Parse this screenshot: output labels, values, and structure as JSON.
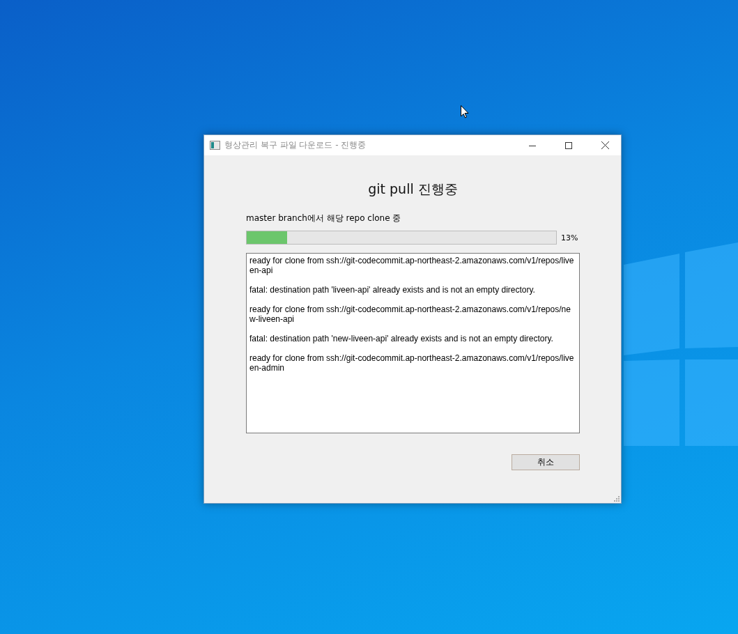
{
  "window": {
    "title": "형상관리 복구 파일 다운로드 - 진행중"
  },
  "heading": "git pull 진행중",
  "status": "master branch에서 해당 repo clone 중",
  "progress": {
    "level": 0.13,
    "reading": "13%"
  },
  "log": [
    "ready for clone from ssh://git-codecommit.ap-northeast-2.amazonaws.com/v1/repos/liveen-api",
    "fatal: destination path 'liveen-api' already exists and is not an empty directory.",
    "ready for clone from ssh://git-codecommit.ap-northeast-2.amazonaws.com/v1/repos/new-liveen-api",
    "fatal: destination path 'new-liveen-api' already exists and is not an empty directory.",
    "ready for clone from ssh://git-codecommit.ap-northeast-2.amazonaws.com/v1/repos/liveen-admin"
  ],
  "buttons": [
    {
      "label": "취소"
    }
  ]
}
